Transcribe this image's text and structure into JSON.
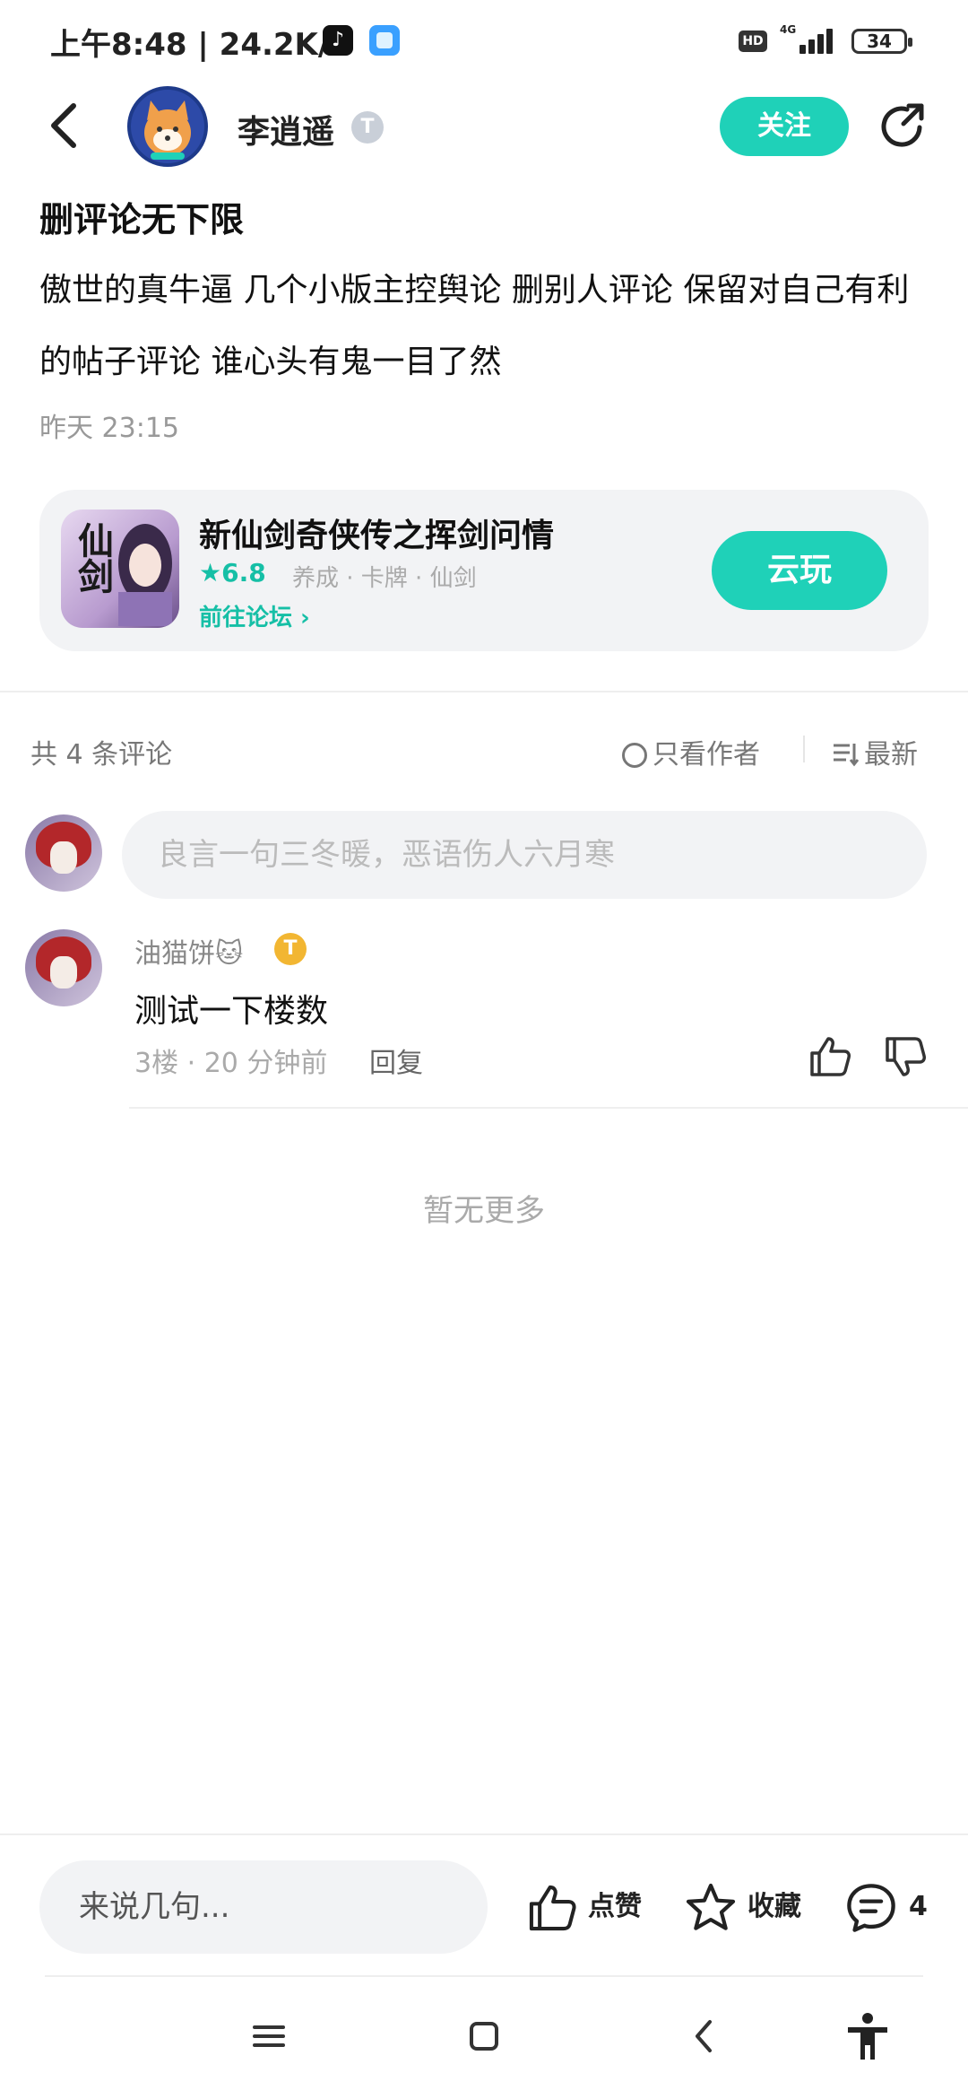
{
  "status_bar": {
    "time_speed": "上午8:48 | 24.2K/s",
    "hd": "HD",
    "network": "4G",
    "battery": "34"
  },
  "header": {
    "username": "李逍遥",
    "level_badge": "T",
    "follow_label": "关注"
  },
  "post": {
    "title": "删评论无下限",
    "body": "傲世的真牛逼 几个小版主控舆论 删别人评论 保留对自己有利的帖子评论 谁心头有鬼一目了然",
    "time": "昨天 23:15"
  },
  "game_card": {
    "icon_text": "仙剑",
    "name": "新仙剑奇侠传之挥剑问情",
    "rating": "★6.8",
    "tags": "养成 · 卡牌 · 仙剑",
    "forum_link": "前往论坛 ›",
    "cloud_play_label": "云玩"
  },
  "comments_header": {
    "count": "共 4 条评论",
    "only_author": "只看作者",
    "sort": "最新"
  },
  "comment_input": {
    "placeholder": "良言一句三冬暖，恶语伤人六月寒"
  },
  "comments": [
    {
      "user": "油猫饼🐱",
      "badge": "T",
      "text": "测试一下楼数",
      "meta": "3楼 · 20 分钟前",
      "reply_label": "回复"
    }
  ],
  "no_more": "暂无更多",
  "bottom_bar": {
    "input_placeholder": "来说几句...",
    "like_label": "点赞",
    "favorite_label": "收藏",
    "comment_count": "4"
  },
  "colors": {
    "accent": "#1fd1b8",
    "rating": "#16bfa6"
  }
}
